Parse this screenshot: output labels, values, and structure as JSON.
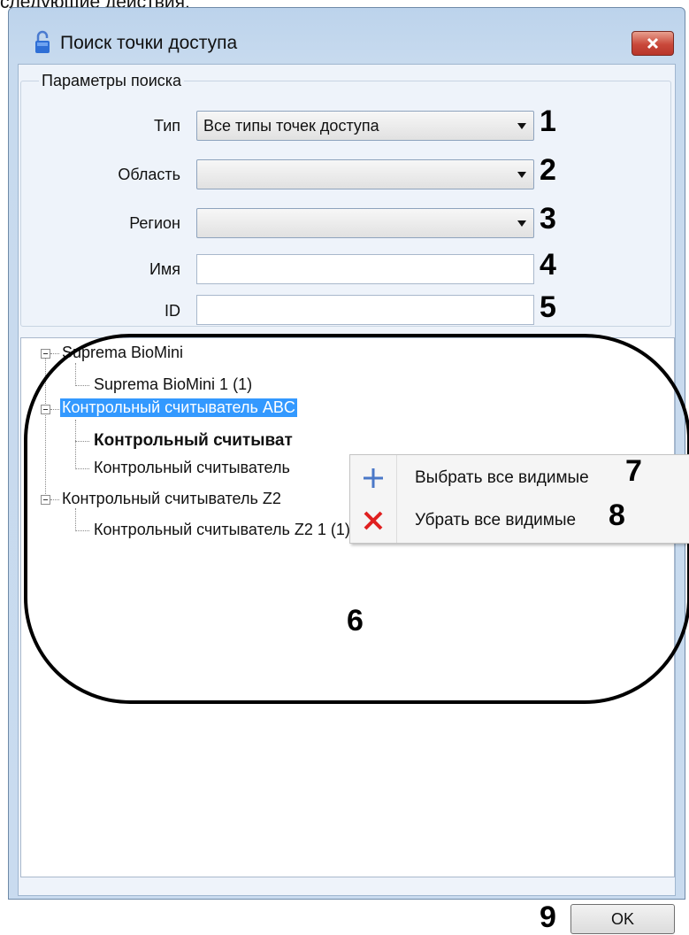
{
  "page_caption": "следующие действия.",
  "window": {
    "title": "Поиск точки доступа",
    "icons": {
      "title_icon": "lock-icon",
      "close": "close-icon"
    }
  },
  "search_params": {
    "legend": "Параметры поиска",
    "type_label": "Тип",
    "type_value": "Все типы точек доступа",
    "area_label": "Область",
    "area_value": "",
    "region_label": "Регион",
    "region_value": "",
    "name_label": "Имя",
    "name_value": "",
    "id_label": "ID",
    "id_value": ""
  },
  "tree": {
    "nodes": [
      {
        "label": "Suprema BioMini",
        "level": 0
      },
      {
        "label": "Suprema BioMini 1 (1)",
        "level": 1
      },
      {
        "label": "Контрольный считыватель ABC",
        "level": 0,
        "selected": true
      },
      {
        "label": "Контрольный считыват",
        "level": 1,
        "bold": true
      },
      {
        "label": "Контрольный считыватель",
        "level": 1
      },
      {
        "label": "Контрольный считыватель Z2",
        "level": 0
      },
      {
        "label": "Контрольный считыватель Z2 1 (1)",
        "level": 1
      }
    ]
  },
  "context_menu": {
    "items": [
      {
        "label": "Выбрать все видимые",
        "icon": "plus-icon"
      },
      {
        "label": "Убрать все видимые",
        "icon": "cross-icon"
      }
    ]
  },
  "footer": {
    "ok_label": "OK"
  },
  "markers": [
    "1",
    "2",
    "3",
    "4",
    "5",
    "6",
    "7",
    "8",
    "9"
  ],
  "colors": {
    "selection": "#3399ff",
    "close_button": "#c9483a",
    "plus_icon": "#4a78c8",
    "cross_icon": "#e02020"
  }
}
